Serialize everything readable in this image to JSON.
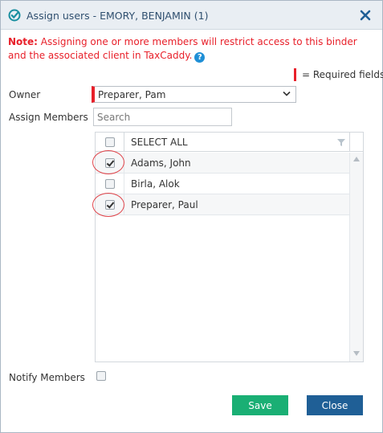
{
  "dialog": {
    "title": "Assign users - EMORY, BENJAMIN (1)"
  },
  "note": {
    "label": "Note:",
    "text": " Assigning one or more members will restrict access to this binder and the associated client in TaxCaddy.",
    "help_glyph": "?"
  },
  "required_legend": "= Required fields",
  "owner": {
    "label": "Owner",
    "value": "Preparer, Pam"
  },
  "assign_members": {
    "label": "Assign Members",
    "search_placeholder": "Search"
  },
  "members_grid": {
    "select_all_label": "SELECT ALL",
    "rows": [
      {
        "name": "Adams, John",
        "checked": true
      },
      {
        "name": "Birla, Alok",
        "checked": false
      },
      {
        "name": "Preparer, Paul",
        "checked": true
      }
    ]
  },
  "notify": {
    "label": "Notify Members",
    "checked": false
  },
  "buttons": {
    "save": "Save",
    "close": "Close"
  },
  "colors": {
    "accent_red": "#e8202a",
    "save_green": "#1aaf74",
    "close_blue": "#1f5f96",
    "title_text": "#2f4f6f",
    "annotation_circle": "#e0454b"
  },
  "icons": {
    "title": "check-circle-icon",
    "close": "close-icon",
    "help": "help-icon",
    "dropdown": "chevron-down-icon",
    "filter": "filter-icon"
  }
}
